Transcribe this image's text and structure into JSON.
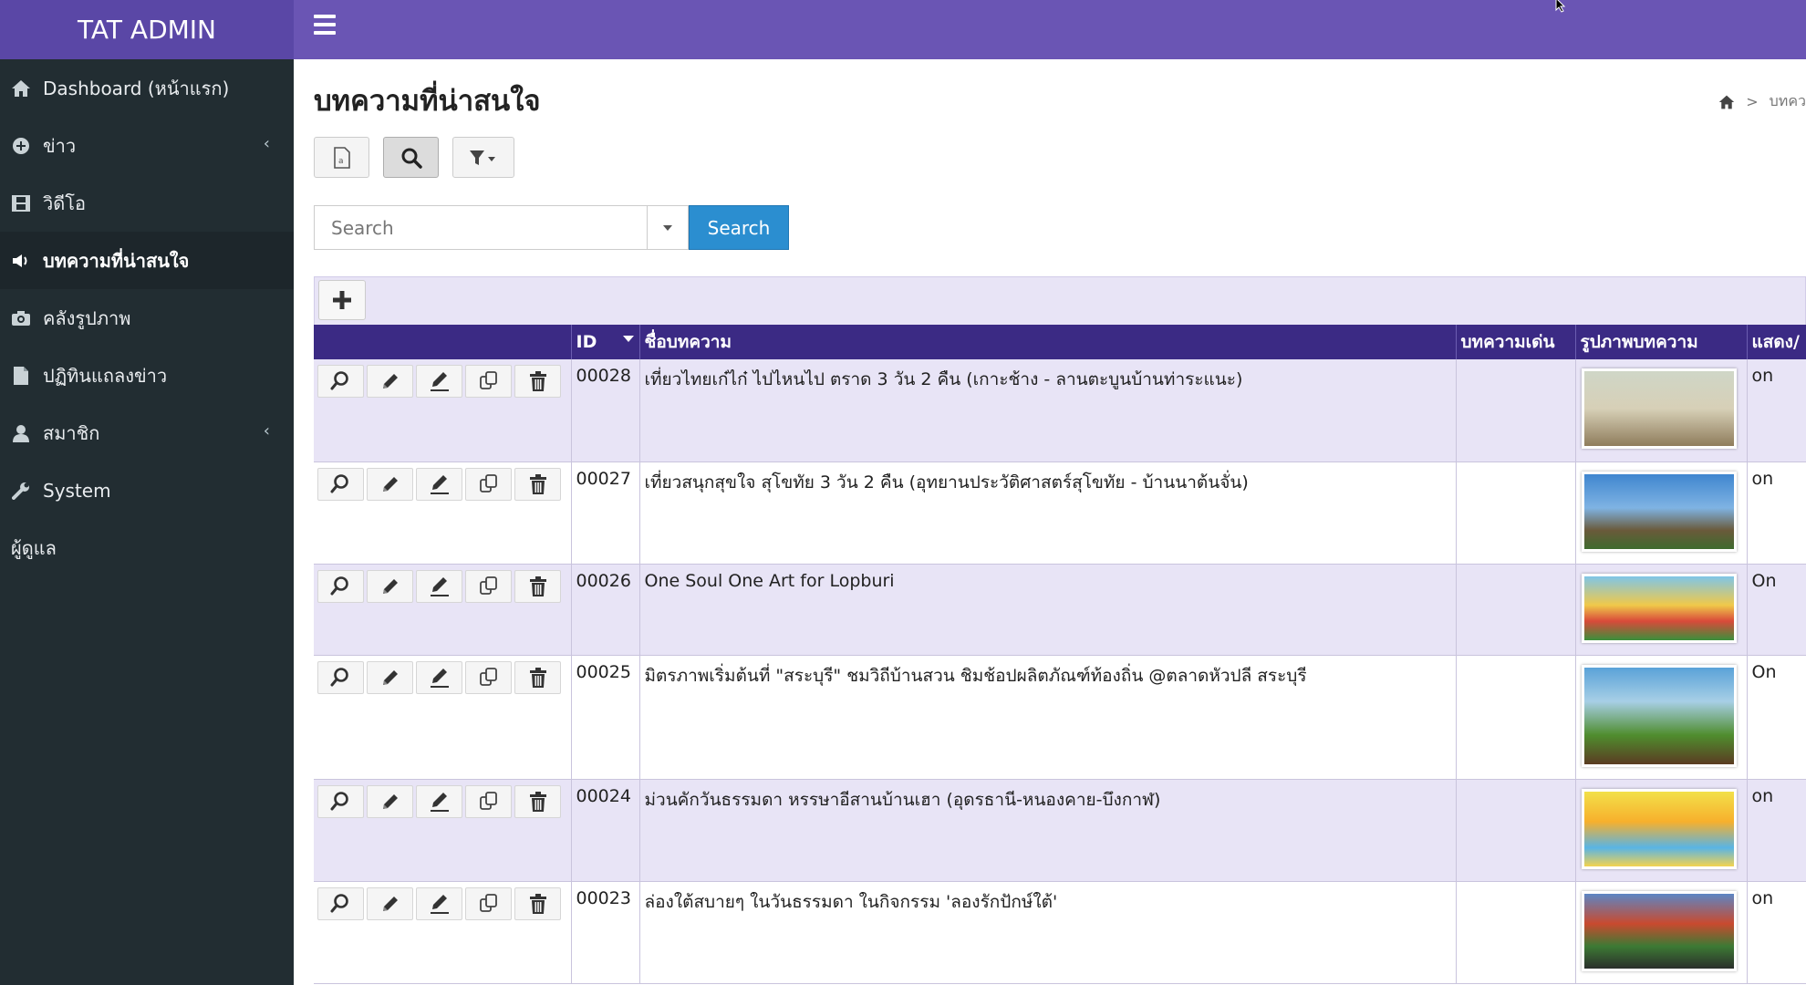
{
  "app": {
    "brand": "TAT ADMIN"
  },
  "colors": {
    "brand_bg": "#5a47a6",
    "topbar_bg": "#6a55b4",
    "sidebar_bg": "#222d32",
    "header_bg": "#3b2a84",
    "row_alt_bg": "#e8e4f6",
    "primary_button": "#2b8ed0"
  },
  "sidebar": {
    "items": [
      {
        "label": "Dashboard (หน้าแรก)",
        "icon": "home-icon",
        "chevron": false,
        "active": false
      },
      {
        "label": "ข่าว",
        "icon": "plus-circle-icon",
        "chevron": true,
        "active": false
      },
      {
        "label": "วิดีโอ",
        "icon": "film-icon",
        "chevron": false,
        "active": false
      },
      {
        "label": "บทความที่น่าสนใจ",
        "icon": "megaphone-icon",
        "chevron": false,
        "active": true
      },
      {
        "label": "คลังรูปภาพ",
        "icon": "camera-icon",
        "chevron": false,
        "active": false
      },
      {
        "label": "ปฏิทินแถลงข่าว",
        "icon": "document-icon",
        "chevron": false,
        "active": false
      },
      {
        "label": "สมาชิก",
        "icon": "user-icon",
        "chevron": true,
        "active": false
      },
      {
        "label": "System",
        "icon": "wrench-icon",
        "chevron": false,
        "active": false
      },
      {
        "label": "ผู้ดูแล",
        "icon": "",
        "chevron": false,
        "active": false
      }
    ],
    "chevron_glyph": "‹"
  },
  "page": {
    "title": "บทความที่น่าสนใจ",
    "breadcrumb": {
      "separator": ">",
      "current": "บทคว"
    }
  },
  "search": {
    "placeholder": "Search",
    "button_label": "Search"
  },
  "grid": {
    "columns": [
      "",
      "ID",
      "ชื่อบทความ",
      "บทความเด่น",
      "รูปภาพบทความ",
      "แสดง/"
    ],
    "rows": [
      {
        "id": "00028",
        "title": "เที่ยวไทยเก๋ไก๋ ไปไหนไป ตราด 3 วัน 2 คืน (เกาะช้าง - ลานตะบูนบ้านท่าระแนะ)",
        "featured": "",
        "show": "on"
      },
      {
        "id": "00027",
        "title": "เที่ยวสนุกสุขใจ สุโขทัย 3 วัน 2 คืน (อุทยานประวัติศาสตร์สุโขทัย - บ้านนาต้นจั่น)",
        "featured": "",
        "show": "on"
      },
      {
        "id": "00026",
        "title": "One Soul One Art for Lopburi",
        "featured": "",
        "show": "On"
      },
      {
        "id": "00025",
        "title": "มิตรภาพเริ่มต้นที่ \"สระบุรี\" ชมวิถีบ้านสวน ชิมช้อปผลิตภัณฑ์ท้องถิ่น @ตลาดหัวปลี สระบุรี",
        "featured": "",
        "show": "On"
      },
      {
        "id": "00024",
        "title": "ม่วนคักวันธรรมดา หรรษาอีสานบ้านเฮา (อุดรธานี-หนองคาย-บึงกาฬ)",
        "featured": "",
        "show": "on"
      },
      {
        "id": "00023",
        "title": "ล่องใต้สบายๆ ในวันธรรมดา ในกิจกรรม 'ลองรักปักษ์ใต้'",
        "featured": "",
        "show": "on"
      }
    ]
  }
}
